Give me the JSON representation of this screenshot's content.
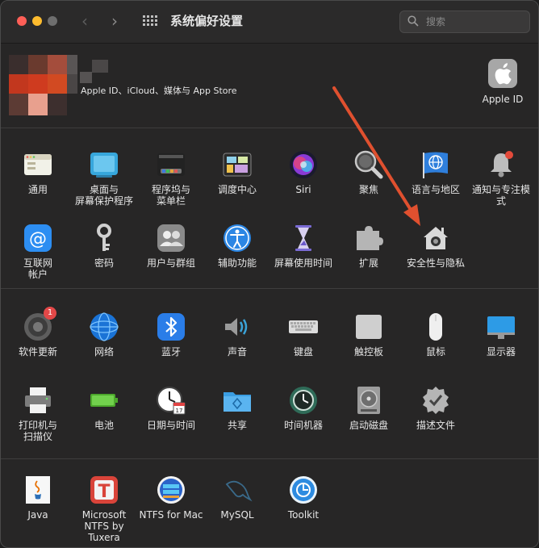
{
  "window": {
    "title": "系统偏好设置",
    "search_placeholder": "搜索"
  },
  "account": {
    "label": "Apple ID、iCloud、媒体与 App Store",
    "apple_id_label": "Apple ID"
  },
  "section1": [
    {
      "label": "通用",
      "icon": "general-icon"
    },
    {
      "label": "桌面与\n屏幕保护程序",
      "icon": "desktop-icon"
    },
    {
      "label": "程序坞与\n菜单栏",
      "icon": "dock-icon"
    },
    {
      "label": "调度中心",
      "icon": "mission-control-icon"
    },
    {
      "label": "Siri",
      "icon": "siri-icon"
    },
    {
      "label": "聚焦",
      "icon": "spotlight-icon"
    },
    {
      "label": "语言与地区",
      "icon": "language-icon"
    },
    {
      "label": "通知与专注模式",
      "icon": "notifications-icon"
    },
    {
      "label": "互联网\n帐户",
      "icon": "internet-accounts-icon"
    },
    {
      "label": "密码",
      "icon": "key-icon"
    },
    {
      "label": "用户与群组",
      "icon": "users-icon"
    },
    {
      "label": "辅助功能",
      "icon": "accessibility-icon"
    },
    {
      "label": "屏幕使用时间",
      "icon": "hourglass-icon"
    },
    {
      "label": "扩展",
      "icon": "extensions-icon"
    },
    {
      "label": "安全性与隐私",
      "icon": "security-icon"
    }
  ],
  "section2": [
    {
      "label": "软件更新",
      "icon": "software-update-icon",
      "badge": "1"
    },
    {
      "label": "网络",
      "icon": "network-icon"
    },
    {
      "label": "蓝牙",
      "icon": "bluetooth-icon"
    },
    {
      "label": "声音",
      "icon": "sound-icon"
    },
    {
      "label": "键盘",
      "icon": "keyboard-icon"
    },
    {
      "label": "触控板",
      "icon": "trackpad-icon"
    },
    {
      "label": "鼠标",
      "icon": "mouse-icon"
    },
    {
      "label": "显示器",
      "icon": "display-icon"
    },
    {
      "label": "打印机与\n扫描仪",
      "icon": "printer-icon"
    },
    {
      "label": "电池",
      "icon": "battery-icon"
    },
    {
      "label": "日期与时间",
      "icon": "clock-icon"
    },
    {
      "label": "共享",
      "icon": "sharing-icon"
    },
    {
      "label": "时间机器",
      "icon": "time-machine-icon"
    },
    {
      "label": "启动磁盘",
      "icon": "startup-disk-icon"
    },
    {
      "label": "描述文件",
      "icon": "profiles-icon"
    }
  ],
  "section3": [
    {
      "label": "Java",
      "icon": "java-icon"
    },
    {
      "label": "Microsoft\nNTFS by Tuxera",
      "icon": "tuxera-icon"
    },
    {
      "label": "NTFS for Mac",
      "icon": "ntfs-for-mac-icon"
    },
    {
      "label": "MySQL",
      "icon": "mysql-icon"
    },
    {
      "label": "Toolkit",
      "icon": "toolkit-icon"
    }
  ],
  "colors": {
    "accent_arrow": "#e0502f",
    "window_bg": "#272626",
    "badge": "#e34848"
  }
}
